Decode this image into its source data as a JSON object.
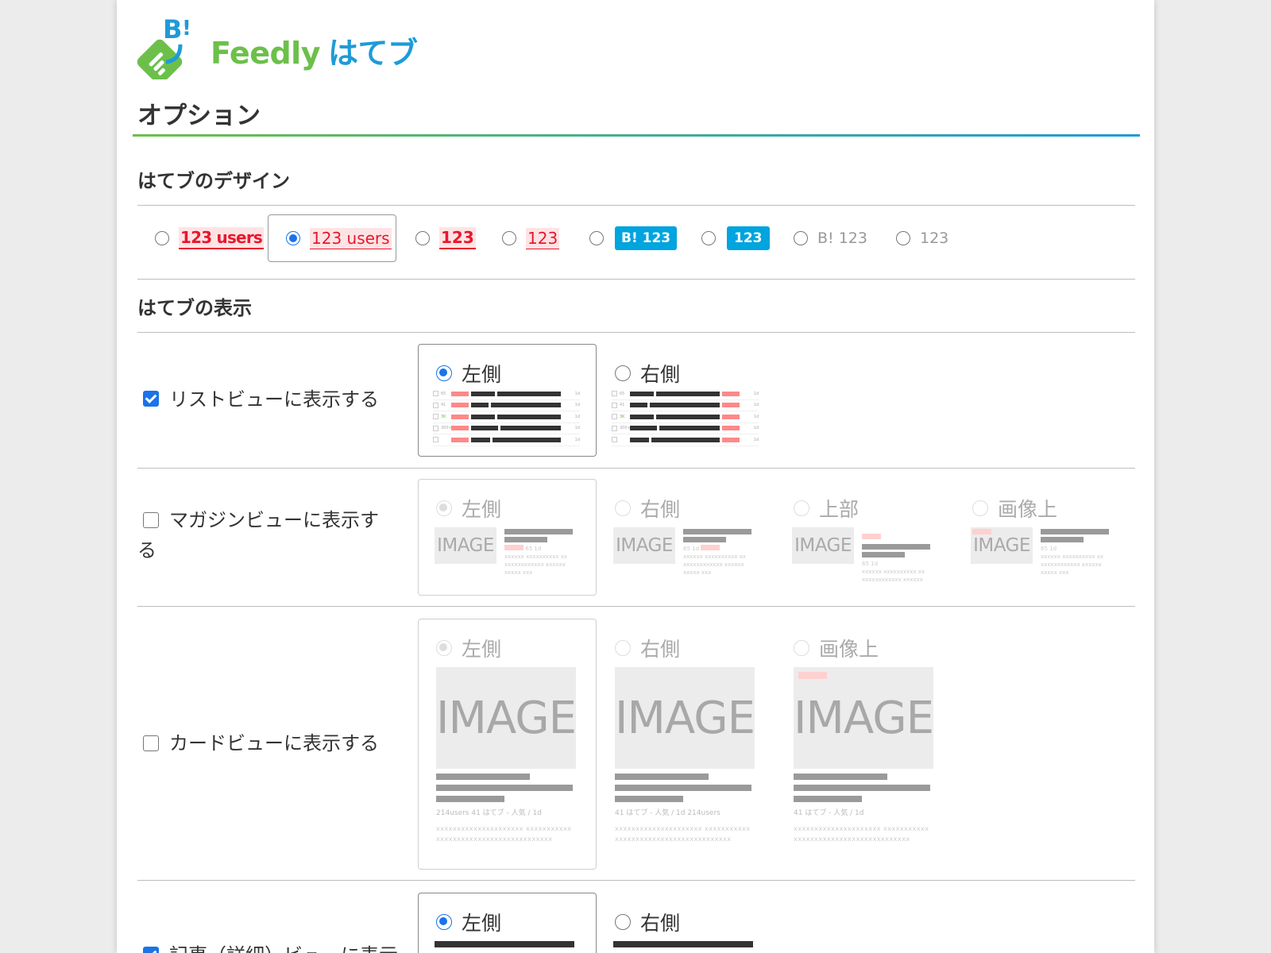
{
  "brand": {
    "name_feedly": "Feedly",
    "name_hatebu": "はてブ"
  },
  "page_title": "オプション",
  "sections": {
    "design_title": "はてブのデザイン",
    "display_title": "はてブの表示"
  },
  "design_options": [
    {
      "label": "123 users",
      "selected": false
    },
    {
      "label": "123 users",
      "selected": true
    },
    {
      "label": "123",
      "selected": false
    },
    {
      "label": "123",
      "selected": false
    },
    {
      "label": "B! 123",
      "selected": false
    },
    {
      "label": "123",
      "selected": false
    },
    {
      "label": "B! 123",
      "selected": false
    },
    {
      "label": "123",
      "selected": false
    }
  ],
  "display_rows": [
    {
      "label": "リストビューに表示する",
      "checked": true,
      "options": [
        "左側",
        "右側"
      ],
      "selected": "左側"
    },
    {
      "label": "マガジンビューに表示する",
      "checked": false,
      "options": [
        "左側",
        "右側",
        "上部",
        "画像上"
      ],
      "selected": "左側"
    },
    {
      "label": "カードビューに表示する",
      "checked": false,
      "options": [
        "左側",
        "右側",
        "画像上"
      ],
      "selected": "左側"
    },
    {
      "label": "記事（詳細）ビューに表示",
      "checked": true,
      "options": [
        "左側",
        "右側"
      ],
      "selected": "左側"
    }
  ],
  "preview": {
    "image_text": "IMAGE",
    "list_counts": [
      "65",
      "41",
      "3K",
      "300+",
      ""
    ],
    "list_badges": [
      "778users",
      "214users",
      "221users",
      "217users",
      "218users"
    ],
    "mag_meta": "65  1d",
    "mag_badge": "778users",
    "mag_desc": "xxxxxx xxxxxxxxxx xx xxxxxxxxxxxx xxxxxx xxxxx xxx",
    "card_meta_left": "214users  41  はてブ - 人気 / 1d",
    "card_meta_right": "41  はてブ - 人気 / 1d  214users",
    "card_meta_top": "41  はてブ - 人気 / 1d",
    "card_badge": "214users",
    "card_desc": "xxxxxxxxxxxxxxxxxxxxx xxxxxxxxxxx xxxxxxxxxxxxxxxxxxxxxxxxxxxx"
  },
  "colors": {
    "green": "#6cc04a",
    "blue": "#1e9bd7",
    "radio_blue": "#1a73e8",
    "hatebu_red": "#e8172c",
    "hatebu_blue": "#00a4de"
  }
}
